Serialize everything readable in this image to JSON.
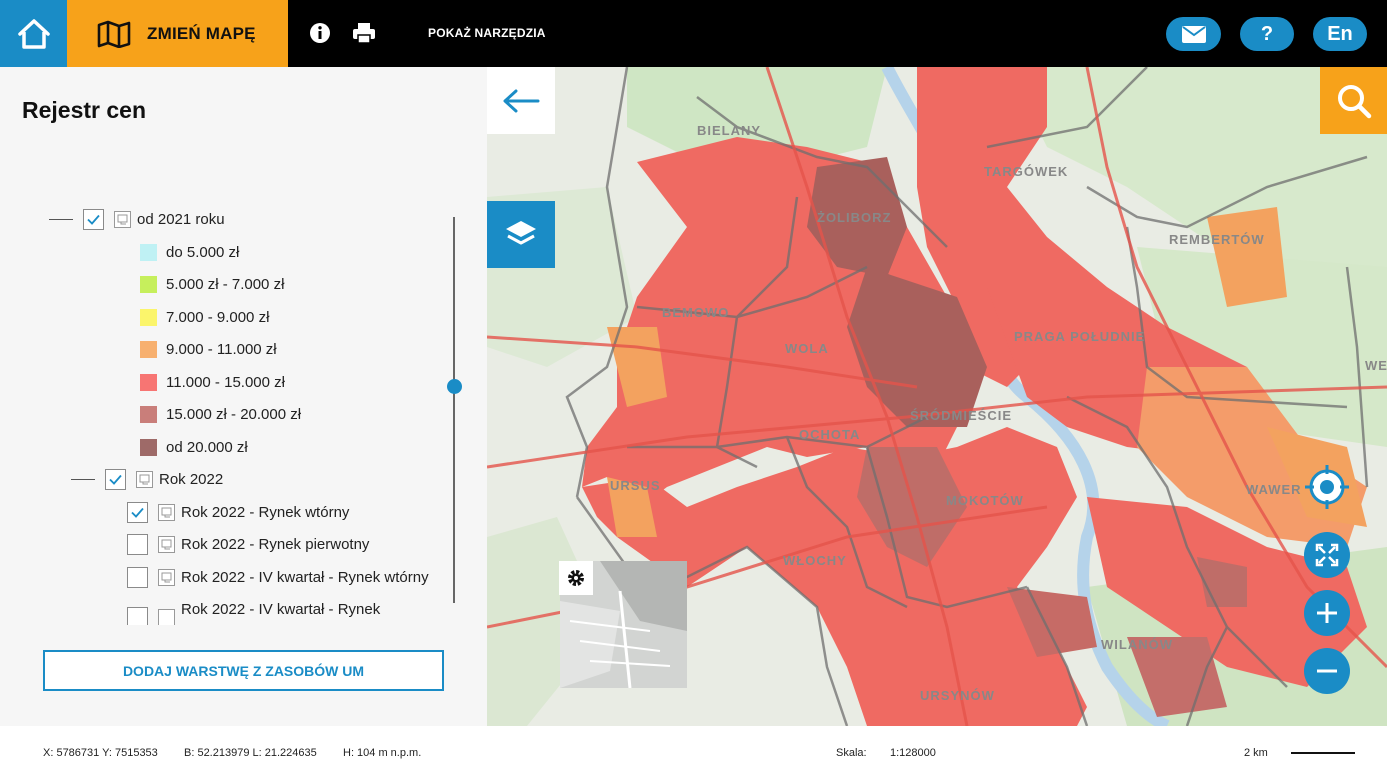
{
  "topbar": {
    "change_map_label": "ZMIEŃ MAPĘ",
    "show_tools_label": "POKAŻ NARZĘDZIA",
    "help_label": "?",
    "language_label": "En"
  },
  "panel": {
    "title": "Rejestr cen",
    "group_2021": "od 2021 roku",
    "legend": [
      {
        "label": "do 5.000 zł",
        "color": "#bff1f4"
      },
      {
        "label": "5.000 zł - 7.000 zł",
        "color": "#c6ef5c"
      },
      {
        "label": "7.000 - 9.000 zł",
        "color": "#fbf56b"
      },
      {
        "label": "9.000 - 11.000 zł",
        "color": "#f7b06f"
      },
      {
        "label": "11.000 - 15.000 zł",
        "color": "#f77573"
      },
      {
        "label": "15.000 zł - 20.000 zł",
        "color": "#c97e7a"
      },
      {
        "label": "od 20.000 zł",
        "color": "#9e6a68"
      }
    ],
    "group_2022": "Rok 2022",
    "layers_2022": [
      {
        "label": "Rok 2022 - Rynek wtórny",
        "checked": true
      },
      {
        "label": "Rok 2022 - Rynek pierwotny",
        "checked": false
      },
      {
        "label": "Rok 2022 - IV kwartał - Rynek wtórny",
        "checked": false
      },
      {
        "label": "Rok 2022 - IV kwartał - Rynek",
        "checked": false
      }
    ],
    "add_layer_label": "DODAJ WARSTWĘ Z ZASOBÓW UM"
  },
  "map": {
    "districts": [
      "BIELANY",
      "TARGÓWEK",
      "ŻOLIBORZ",
      "REMBERTÓW",
      "BEMOWO",
      "PRAGA POŁUDNIE",
      "WOLA",
      "ŚRÓDMIEŚCIE",
      "OCHOTA",
      "URSUS",
      "MOKOTÓW",
      "WAWER",
      "WŁOCHY",
      "WILANÓW",
      "URSYNÓW",
      "WE"
    ]
  },
  "status": {
    "xy": "X: 5786731 Y: 7515353",
    "bl": "B: 52.213979 L: 21.224635",
    "height": "H: 104 m n.p.m.",
    "scale_label": "Skala:",
    "scale_value": "1:128000",
    "scalebar_label": "2 km"
  }
}
